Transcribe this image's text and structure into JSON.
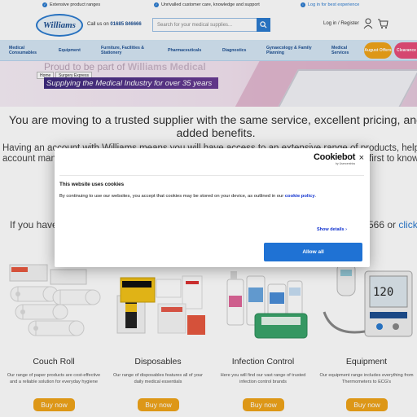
{
  "topbar": {
    "items": [
      {
        "label": "Extensive product ranges"
      },
      {
        "label": "Unrivalled customer care, knowledge and support"
      },
      {
        "label": "Log in for best experience"
      }
    ]
  },
  "header": {
    "logo_text": "Williams",
    "call_label": "Call us on",
    "phone": "01685 846666",
    "search_placeholder": "Search for your medical supplies...",
    "login_register": "Log in / Register"
  },
  "nav": {
    "items": [
      {
        "label": "Medical Consumables"
      },
      {
        "label": "Equipment"
      },
      {
        "label": "Furniture, Facilities & Stationery"
      },
      {
        "label": "Pharmaceuticals"
      },
      {
        "label": "Diagnostics"
      },
      {
        "label": "Gynaecology & Family Planning"
      },
      {
        "label": "Medical Services"
      }
    ],
    "pills": [
      {
        "label": "August Offers",
        "color": "#f0a419"
      },
      {
        "label": "Clearance",
        "color": "#e84e7a"
      }
    ]
  },
  "banner": {
    "proud_prefix": "Proud to be part of",
    "proud_brand": "Williams Medical",
    "breadcrumb": [
      "Home",
      "Surgery Express"
    ],
    "tagline": "Supplying the Medical Industry for over 35 years"
  },
  "intro": {
    "line1": "You are moving to a trusted supplier with the same service, excellent pricing, and added benefits.",
    "line2a": "Having an account with Williams means you will have access to an extensive range of products, helpful",
    "line2b": "account man",
    "line2c": "first to know",
    "line3_prefix": "If you have",
    "line3_suffix": "566 or",
    "line3_link": "click"
  },
  "products": [
    {
      "name": "Couch Roll",
      "description": "Our range of paper products are cost-effective and a reliable solution for everyday hygiene",
      "button": "Buy now"
    },
    {
      "name": "Disposables",
      "description": "Our range of disposables features all of your daily medical essentials",
      "button": "Buy now"
    },
    {
      "name": "Infection Control",
      "description": "Here you will find our vast range of trusted infection control brands",
      "button": "Buy now"
    },
    {
      "name": "Equipment",
      "description": "Our equipment range includes everything from Thermometers to ECG's",
      "button": "Buy now"
    }
  ],
  "cookie_dialog": {
    "brand": "Cookiebot",
    "brand_sub": "by Usercentrics",
    "title": "This website uses cookies",
    "text": "By continuing to use our websites, you accept that cookies may be stored on your device, as outlined in our",
    "link": "cookie policy",
    "text_end": ".",
    "show_details": "Show details",
    "allow_button": "Allow all",
    "close": "×"
  },
  "colors": {
    "brand_blue": "#2b7bd0",
    "nav_bg": "#d6e8f6",
    "buy_button": "#f0a419",
    "allow_button": "#1f72d4"
  }
}
